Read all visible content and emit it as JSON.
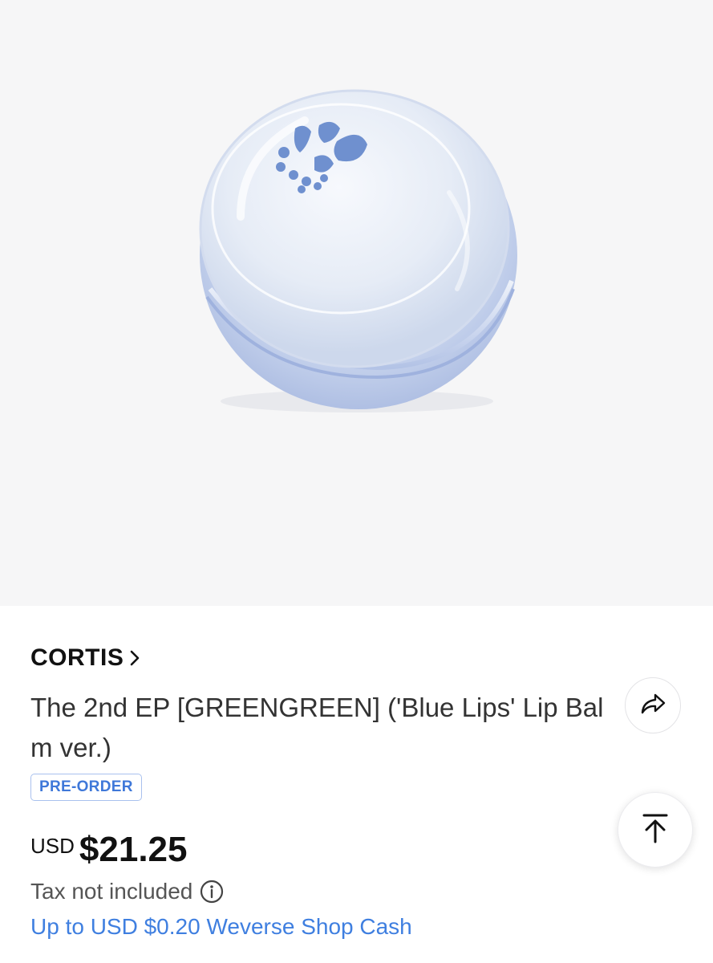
{
  "product": {
    "artist": "CORTIS",
    "title": "The 2nd EP [GREENGREEN] ('Blue Lips' Lip Balm ver.)",
    "badge": "PRE-ORDER",
    "currency": "USD",
    "price": "$21.25",
    "tax_note": "Tax not included",
    "cash_note": "Up to USD $0.20 Weverse Shop Cash"
  },
  "icons": {
    "artist_link": "chevron-right-icon",
    "share": "share-icon",
    "scroll_top": "arrow-to-top-icon",
    "tax_info": "info-icon"
  },
  "colors": {
    "accent_blue": "#3f7fe0",
    "badge_border": "#a9c1ee",
    "hero_background": "#f6f6f7"
  }
}
